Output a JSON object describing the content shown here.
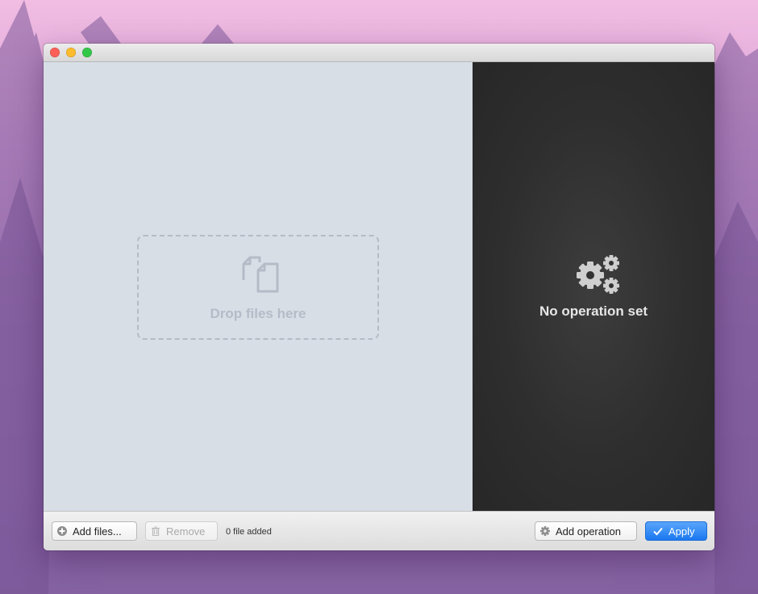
{
  "window": {
    "title": ""
  },
  "drop_zone": {
    "text": "Drop files here",
    "icon": "documents-icon"
  },
  "operation_panel": {
    "text": "No operation set",
    "icon": "gears-icon"
  },
  "toolbar": {
    "add_files_label": "Add files...",
    "remove_label": "Remove",
    "file_count": "0 file added",
    "add_operation_label": "Add operation",
    "apply_label": "Apply"
  },
  "colors": {
    "accent": "#1a78f0",
    "left_pane": "#d8dee6",
    "right_pane": "#2e2e2e"
  }
}
